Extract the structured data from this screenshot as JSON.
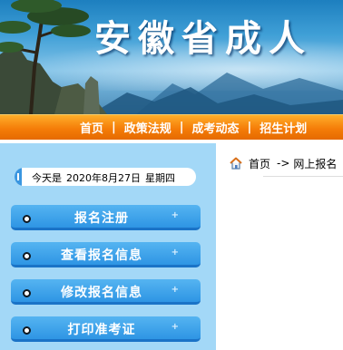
{
  "banner": {
    "title": "安徽省成人"
  },
  "nav": {
    "items": [
      {
        "label": "首页"
      },
      {
        "label": "政策法规"
      },
      {
        "label": "成考动态"
      },
      {
        "label": "招生计划"
      }
    ],
    "separator": "|"
  },
  "sidebar": {
    "date_label": "今天是",
    "date_value": "2020年8月27日",
    "weekday": "星期四",
    "menu": [
      {
        "label": "报名注册"
      },
      {
        "label": "查看报名信息"
      },
      {
        "label": "修改报名信息"
      },
      {
        "label": "打印准考证"
      }
    ],
    "menu_expand_symbol": "+"
  },
  "breadcrumb": {
    "home": "首页",
    "arrow": "->",
    "current": "网上报名"
  },
  "colors": {
    "nav_orange": "#f57d08",
    "sidebar_blue": "#a3d8f7",
    "button_blue": "#2e95e4"
  },
  "icons": {
    "home": "home-icon",
    "bullet": "bullet-icon"
  }
}
